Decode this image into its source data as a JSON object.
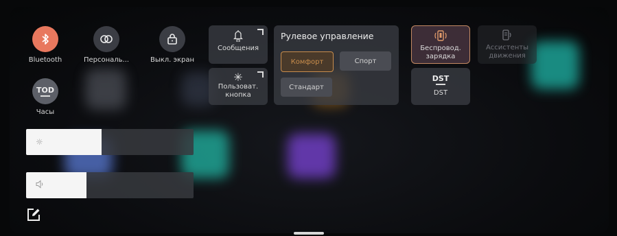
{
  "quick_buttons": [
    {
      "label": "Bluetooth",
      "icon": "bluetooth-icon",
      "state": "on"
    },
    {
      "label": "Персональ...",
      "icon": "link-icon",
      "state": "off"
    },
    {
      "label": "Выкл. экран",
      "icon": "lock-icon",
      "state": "off"
    },
    {
      "label": "Часы",
      "icon": "tod-icon",
      "icon_text": "TOD",
      "state": "off"
    }
  ],
  "tiles": {
    "messages": {
      "label": "Сообщения",
      "icon": "bell-icon"
    },
    "custom_button": {
      "label_line1": "Пользоват.",
      "label_line2": "кнопка",
      "icon": "asterisk-icon"
    },
    "wireless_charging": {
      "label_line1": "Беспровод.",
      "label_line2": "зарядка",
      "icon": "wireless-charging-icon"
    },
    "motion_assist": {
      "label_line1": "Ассистенты",
      "label_line2": "движения",
      "icon": "motion-assist-icon",
      "state": "disabled"
    },
    "dst": {
      "icon_text": "DST",
      "label": "DST"
    }
  },
  "steering": {
    "title": "Рулевое управление",
    "options": [
      {
        "label": "Комфорт",
        "selected": true
      },
      {
        "label": "Спорт",
        "selected": false
      },
      {
        "label": "Стандарт",
        "selected": false
      }
    ]
  },
  "sliders": {
    "brightness": {
      "icon": "sun-icon",
      "level": 0.45
    },
    "volume": {
      "icon": "speaker-icon",
      "level": 0.36
    }
  },
  "colors": {
    "accent_bluetooth": "#e8785e",
    "accent_selected": "#c98d4c",
    "accent_charging": "#e19b6b"
  }
}
